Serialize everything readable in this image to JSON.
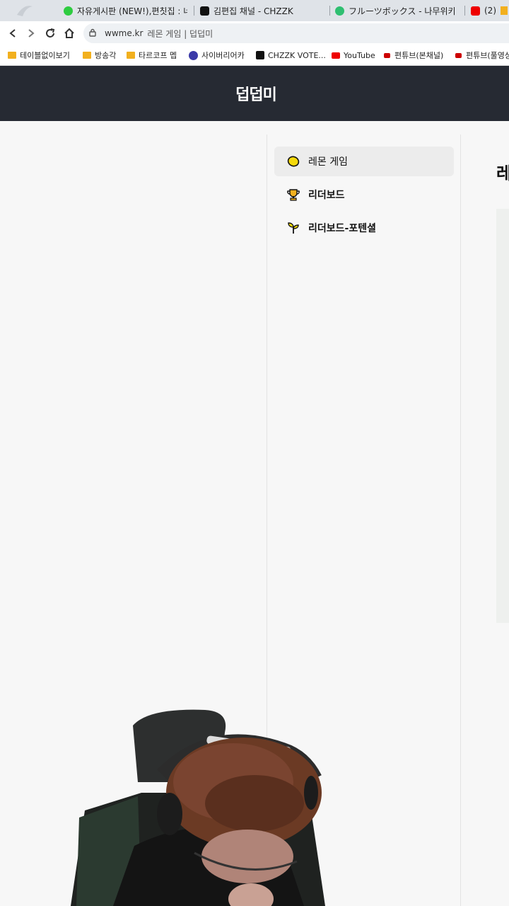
{
  "browser": {
    "tabs": [
      {
        "label": "자유게시판 (NEW!),편칫집 : 네",
        "favicon_color": "#2ecc40"
      },
      {
        "label": "김편집 채널 - CHZZK",
        "favicon_color": "#111111"
      },
      {
        "label": "フルーツボックス - 나무위키",
        "favicon_color": "#2fbf71"
      },
      {
        "label": "(2)",
        "favicon_color": "#e00000"
      }
    ],
    "address": {
      "url": "wwme.kr",
      "page_title": "레몬 게임 | 덥덥미"
    },
    "bookmarks": [
      {
        "label": "테이블없이보기",
        "icon": "folder-icon"
      },
      {
        "label": "방송각",
        "icon": "folder-icon"
      },
      {
        "label": "타르코프 멥",
        "icon": "folder-icon"
      },
      {
        "label": "사이버리어카",
        "icon": "circle-logo-icon"
      },
      {
        "label": "CHZZK VOTE...",
        "icon": "chzzk-icon"
      },
      {
        "label": "YouTube",
        "icon": "youtube-icon"
      },
      {
        "label": "편튜브(본채널)",
        "icon": "youtube-icon"
      },
      {
        "label": "편튜브(풀영상",
        "icon": "youtube-icon"
      }
    ]
  },
  "site": {
    "logo": "덥덥미",
    "header_color": "#262a33"
  },
  "sidebar": {
    "items": [
      {
        "label": "레몬 게임",
        "icon": "lemon-icon",
        "active": true
      },
      {
        "label": "리더보드",
        "icon": "trophy-icon",
        "active": false
      },
      {
        "label": "리더보드-포텐셜",
        "icon": "sprout-icon",
        "active": false
      }
    ]
  },
  "main": {
    "title": "레몬 게임"
  }
}
